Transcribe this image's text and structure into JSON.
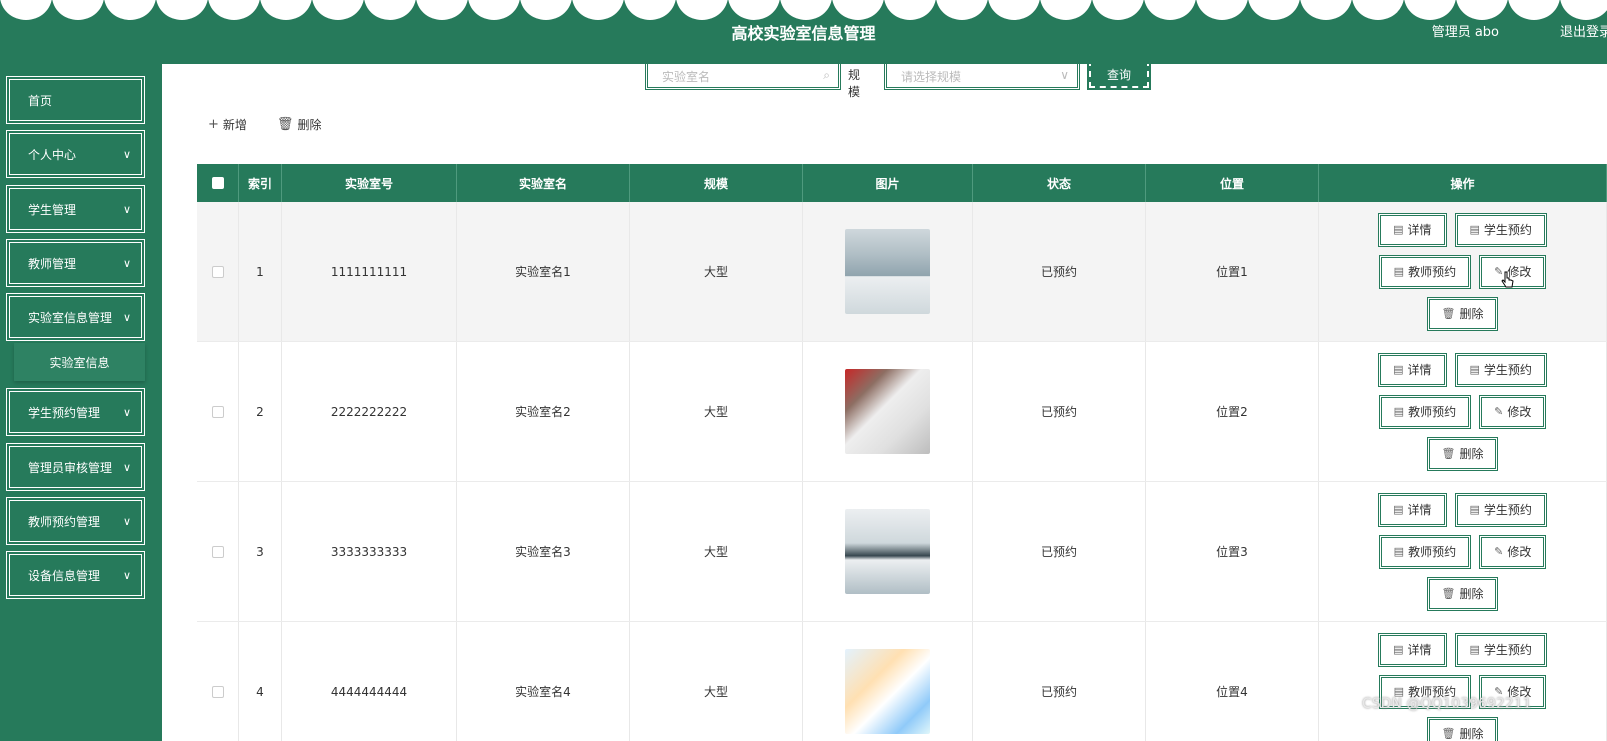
{
  "header": {
    "title": "高校实验室信息管理",
    "user": "管理员 abo",
    "logout": "退出登录"
  },
  "sidebar": {
    "items": [
      {
        "label": "首页",
        "has_children": false
      },
      {
        "label": "个人中心",
        "has_children": true
      },
      {
        "label": "学生管理",
        "has_children": true
      },
      {
        "label": "教师管理",
        "has_children": true
      },
      {
        "label": "实验室信息管理",
        "has_children": true
      },
      {
        "label": "学生预约管理",
        "has_children": true
      },
      {
        "label": "管理员审核管理",
        "has_children": true
      },
      {
        "label": "教师预约管理",
        "has_children": true
      },
      {
        "label": "设备信息管理",
        "has_children": true
      }
    ],
    "submenu_active": "实验室信息"
  },
  "search": {
    "name_placeholder": "实验室名",
    "size_label": "规模",
    "size_placeholder": "请选择规模",
    "query_label": "查询"
  },
  "toolbar": {
    "add_label": "新增",
    "delete_label": "删除"
  },
  "table": {
    "columns": [
      "索引",
      "实验室号",
      "实验室名",
      "规模",
      "图片",
      "状态",
      "位置",
      "操作"
    ],
    "rows": [
      {
        "index": "1",
        "lab_no": "1111111111",
        "lab_name": "实验室名1",
        "scale": "大型",
        "status": "已预约",
        "location": "位置1"
      },
      {
        "index": "2",
        "lab_no": "2222222222",
        "lab_name": "实验室名2",
        "scale": "大型",
        "status": "已预约",
        "location": "位置2"
      },
      {
        "index": "3",
        "lab_no": "3333333333",
        "lab_name": "实验室名3",
        "scale": "大型",
        "status": "已预约",
        "location": "位置3"
      },
      {
        "index": "4",
        "lab_no": "4444444444",
        "lab_name": "实验室名4",
        "scale": "大型",
        "status": "已预约",
        "location": "位置4"
      }
    ],
    "ops": {
      "detail": "详情",
      "student_booking": "学生预约",
      "teacher_booking": "教师预约",
      "edit": "修改",
      "delete": "删除"
    }
  },
  "watermark": "CSDN @QQ1039692211",
  "colors": {
    "primary": "#267a5b",
    "header_text": "#ffffff"
  }
}
